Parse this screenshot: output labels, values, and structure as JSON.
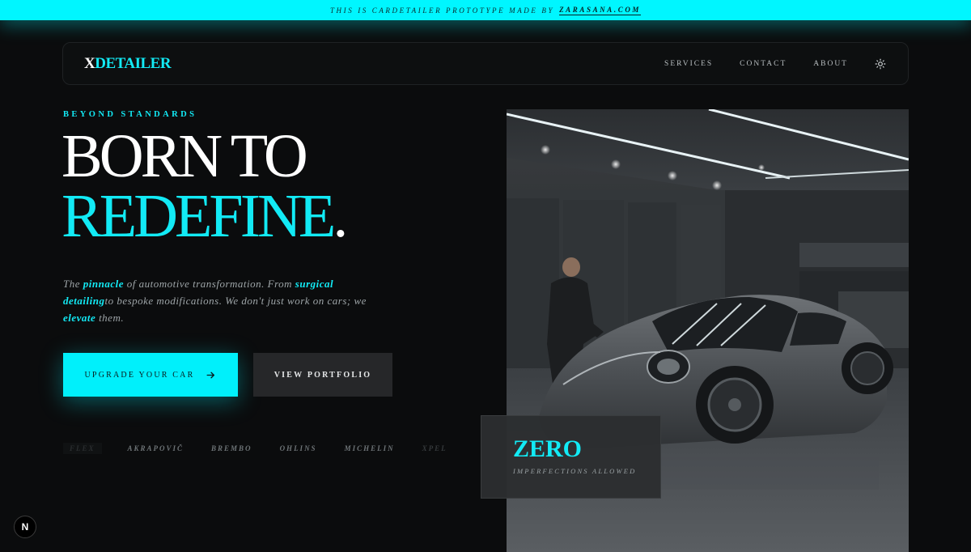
{
  "topbar": {
    "text": "THIS IS CARDETAILER PROTOTYPE MADE BY",
    "link": "ZARASANA.COM"
  },
  "nav": {
    "logo_x": "X",
    "logo_rest": "DETAILER",
    "links": [
      "SERVICES",
      "CONTACT",
      "ABOUT"
    ],
    "theme_icon": "sun-icon"
  },
  "hero": {
    "eyebrow": "BEYOND STANDARDS",
    "headline_line1": "BORN TO",
    "headline_line2": "REDEFINE",
    "headline_dot": ".",
    "description": {
      "p1": "The ",
      "h1": "pinnacle",
      "p2": " of automotive transformation. From ",
      "h2": "surgical detailing",
      "p3": "to bespoke modifications. We don't just work on cars; we ",
      "h3": "elevate",
      "p4": " them."
    },
    "primary_button": "UPGRADE YOUR CAR",
    "secondary_button": "VIEW PORTFOLIO",
    "brands": [
      "FLEX",
      "AKRAPOVIČ",
      "BREMBO",
      "OHLINS",
      "MICHELIN",
      "XPEL"
    ]
  },
  "stat": {
    "value": "ZERO",
    "label": "IMPERFECTIONS ALLOWED"
  },
  "badge": {
    "letter": "N"
  },
  "colors": {
    "accent": "#12eaf5",
    "topbar": "#00f6ff",
    "background": "#0b0c0d"
  }
}
